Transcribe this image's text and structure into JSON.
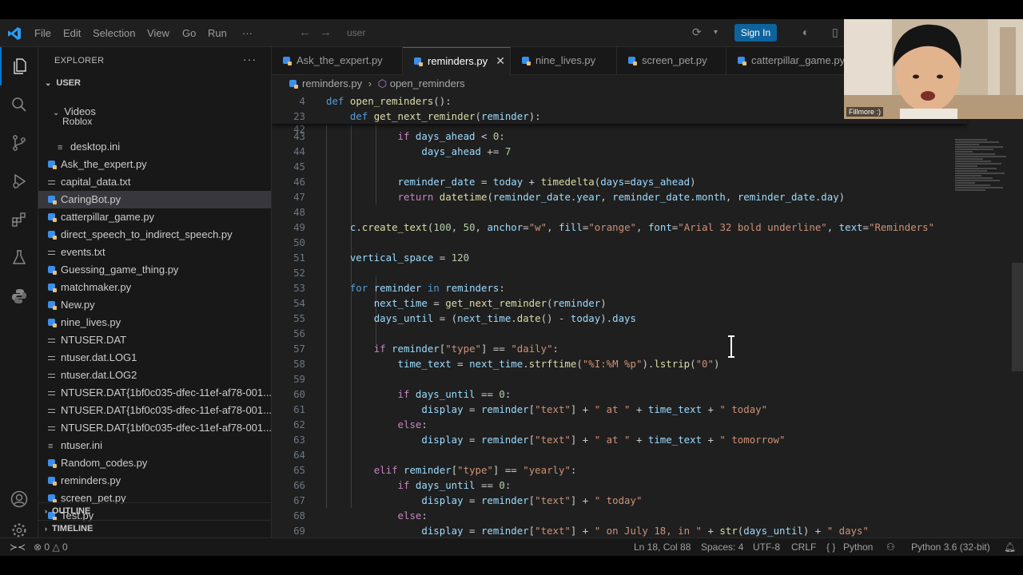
{
  "title_bar": {
    "menus": [
      "File",
      "Edit",
      "Selection",
      "View",
      "Go",
      "Run",
      "···"
    ],
    "search_placeholder": "user",
    "sign_in": "Sign In"
  },
  "sidebar": {
    "title": "EXPLORER",
    "dots": "···",
    "root": "USER",
    "items": [
      {
        "label": "Videos",
        "kind": "folder"
      },
      {
        "label": "Roblox",
        "kind": "folder"
      },
      {
        "label": "desktop.ini",
        "kind": "ini"
      },
      {
        "label": "Ask_the_expert.py",
        "kind": "py"
      },
      {
        "label": "capital_data.txt",
        "kind": "txt"
      },
      {
        "label": "CaringBot.py",
        "kind": "py"
      },
      {
        "label": "catterpillar_game.py",
        "kind": "py"
      },
      {
        "label": "direct_speech_to_indirect_speech.py",
        "kind": "py"
      },
      {
        "label": "events.txt",
        "kind": "txt"
      },
      {
        "label": "Guessing_game_thing.py",
        "kind": "py"
      },
      {
        "label": "matchmaker.py",
        "kind": "py"
      },
      {
        "label": "New.py",
        "kind": "py"
      },
      {
        "label": "nine_lives.py",
        "kind": "py"
      },
      {
        "label": "NTUSER.DAT",
        "kind": "txt"
      },
      {
        "label": "ntuser.dat.LOG1",
        "kind": "txt"
      },
      {
        "label": "ntuser.dat.LOG2",
        "kind": "txt"
      },
      {
        "label": "NTUSER.DAT{1bf0c035-dfec-11ef-af78-001...",
        "kind": "txt"
      },
      {
        "label": "NTUSER.DAT{1bf0c035-dfec-11ef-af78-001...",
        "kind": "txt"
      },
      {
        "label": "NTUSER.DAT{1bf0c035-dfec-11ef-af78-001...",
        "kind": "txt"
      },
      {
        "label": "ntuser.ini",
        "kind": "ini"
      },
      {
        "label": "Random_codes.py",
        "kind": "py"
      },
      {
        "label": "reminders.py",
        "kind": "py"
      },
      {
        "label": "screen_pet.py",
        "kind": "py"
      },
      {
        "label": "Test.py",
        "kind": "py"
      }
    ],
    "outline": "OUTLINE",
    "timeline": "TIMELINE"
  },
  "tabs": [
    {
      "label": "Ask_the_expert.py"
    },
    {
      "label": "reminders.py",
      "active": true,
      "close": "✕"
    },
    {
      "label": "nine_lives.py"
    },
    {
      "label": "screen_pet.py"
    },
    {
      "label": "catterpillar_game.py"
    }
  ],
  "breadcrumb": {
    "file": "reminders.py",
    "symbol": "open_reminders",
    "sep": "›"
  },
  "editor": {
    "sticky": [
      {
        "n": "4",
        "code": "def open_reminders():"
      },
      {
        "n": "23",
        "code": "    def get_next_reminder(reminder):"
      }
    ],
    "lines": [
      {
        "n": "42",
        "code": ""
      },
      {
        "n": "43",
        "code": "            if days_ahead < 0:"
      },
      {
        "n": "44",
        "code": "                days_ahead += 7"
      },
      {
        "n": "45",
        "code": ""
      },
      {
        "n": "46",
        "code": "            reminder_date = today + timedelta(days=days_ahead)"
      },
      {
        "n": "47",
        "code": "            return datetime(reminder_date.year, reminder_date.month, reminder_date.day)"
      },
      {
        "n": "48",
        "code": ""
      },
      {
        "n": "49",
        "code": "    c.create_text(100, 50, anchor=\"w\", fill=\"orange\", font=\"Arial 32 bold underline\", text=\"Reminders\""
      },
      {
        "n": "50",
        "code": ""
      },
      {
        "n": "51",
        "code": "    vertical_space = 120"
      },
      {
        "n": "52",
        "code": ""
      },
      {
        "n": "53",
        "code": "    for reminder in reminders:"
      },
      {
        "n": "54",
        "code": "        next_time = get_next_reminder(reminder)"
      },
      {
        "n": "55",
        "code": "        days_until = (next_time.date() - today).days"
      },
      {
        "n": "56",
        "code": ""
      },
      {
        "n": "57",
        "code": "        if reminder[\"type\"] == \"daily\":"
      },
      {
        "n": "58",
        "code": "            time_text = next_time.strftime(\"%I:%M %p\").lstrip(\"0\")"
      },
      {
        "n": "59",
        "code": ""
      },
      {
        "n": "60",
        "code": "            if days_until == 0:"
      },
      {
        "n": "61",
        "code": "                display = reminder[\"text\"] + \" at \" + time_text + \" today\""
      },
      {
        "n": "62",
        "code": "            else:"
      },
      {
        "n": "63",
        "code": "                display = reminder[\"text\"] + \" at \" + time_text + \" tomorrow\""
      },
      {
        "n": "64",
        "code": ""
      },
      {
        "n": "65",
        "code": "        elif reminder[\"type\"] == \"yearly\":"
      },
      {
        "n": "66",
        "code": "            if days_until == 0:"
      },
      {
        "n": "67",
        "code": "                display = reminder[\"text\"] + \" today\""
      },
      {
        "n": "68",
        "code": "            else:"
      },
      {
        "n": "69",
        "code": "                display = reminder[\"text\"] + \" on July 18, in \" + str(days_until) + \" days\""
      }
    ]
  },
  "status_bar": {
    "errors": "0",
    "warnings": "0",
    "position": "Ln 18, Col 88",
    "spaces": "Spaces: 4",
    "encoding": "UTF-8",
    "eol": "CRLF",
    "braces": "{ }",
    "language": "Python",
    "interpreter": "Python 3.6 (32-bit)"
  },
  "webcam": {
    "name": "Fillmore :)"
  },
  "colors": {
    "keyword": "#569cd6",
    "control": "#c586c0",
    "function": "#dcdcaa",
    "string": "#ce9178",
    "number": "#b5cea8",
    "variable": "#9cdcfe",
    "accent": "#0078d4"
  }
}
